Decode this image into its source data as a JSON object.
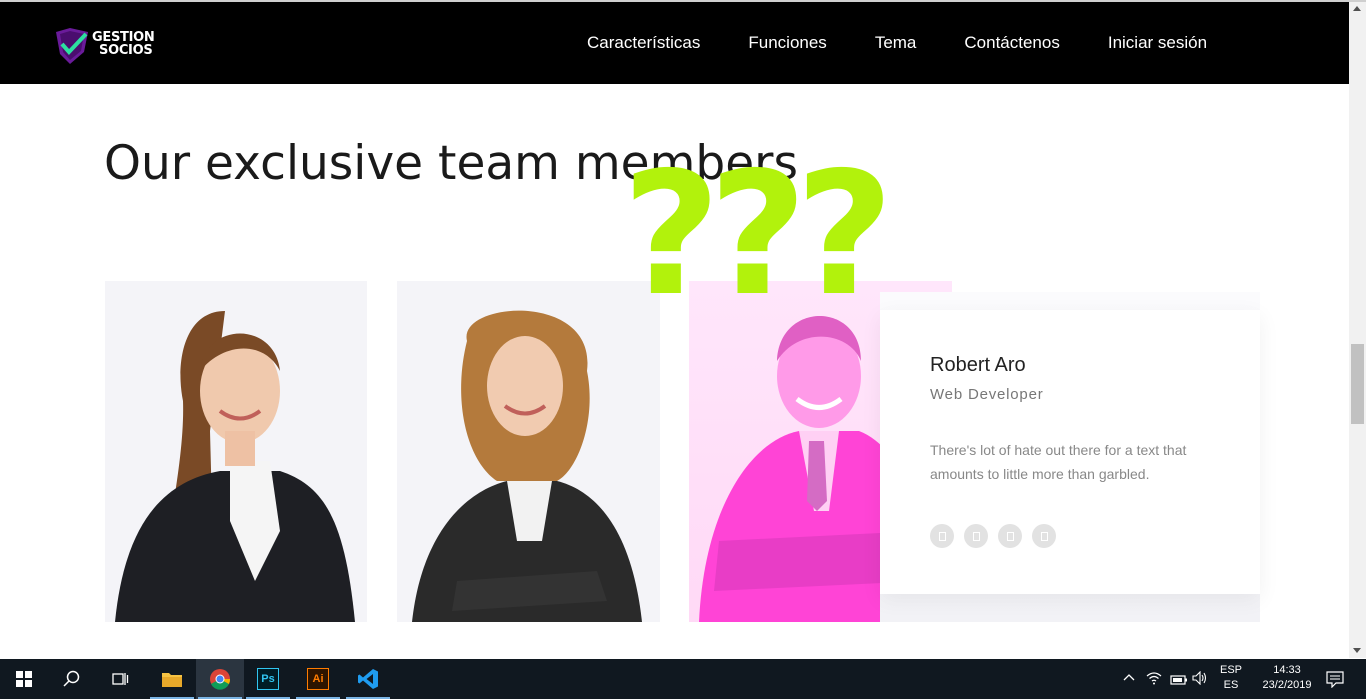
{
  "brand": {
    "line1": "GESTION",
    "line2": "SOCIOS"
  },
  "nav": [
    {
      "label": "Características"
    },
    {
      "label": "Funciones"
    },
    {
      "label": "Tema"
    },
    {
      "label": "Contáctenos"
    },
    {
      "label": "Iniciar sesión"
    }
  ],
  "section": {
    "heading": "Our exclusive team members"
  },
  "overlay": {
    "text": "???"
  },
  "team": [
    {
      "photo": "woman-long-hair"
    },
    {
      "photo": "woman-curly-hair"
    },
    {
      "photo": "man-pink-suit",
      "name": "Robert Aro",
      "role": "Web Developer",
      "description": "There's lot of hate out there for a text that amounts to little more than garbled."
    }
  ],
  "taskbar": {
    "apps": [
      "start-icon",
      "search-icon",
      "task-view-icon",
      "file-explorer-icon",
      "chrome-icon",
      "photoshop-icon",
      "illustrator-icon",
      "vscode-icon"
    ],
    "ps_label": "Ps",
    "ai_label": "Ai",
    "lang_top": "ESP",
    "lang_bottom": "ES",
    "time": "14:33",
    "date": "23/2/2019"
  },
  "colors": {
    "accent": "#b2f20c",
    "nav_bg": "#000000",
    "pink": "#ff44d6"
  }
}
